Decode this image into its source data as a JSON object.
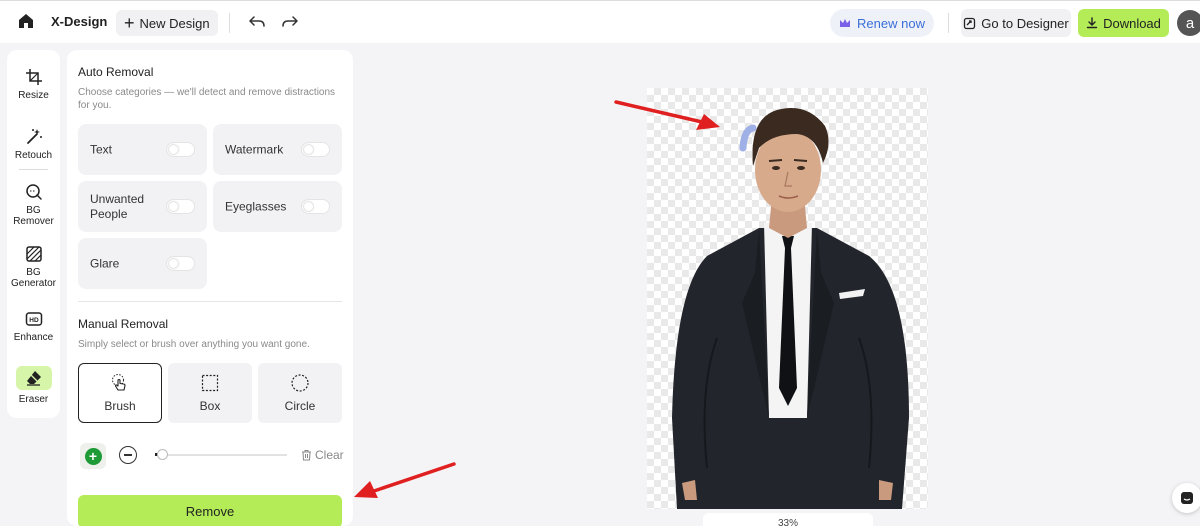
{
  "header": {
    "brand": "X-Design",
    "new_design_label": "New Design",
    "renew_label": "Renew now",
    "goto_label": "Go to Designer",
    "download_label": "Download",
    "avatar_letter": "a"
  },
  "sidebar": {
    "items": [
      {
        "label": "Resize",
        "icon": "crop-icon"
      },
      {
        "label": "Retouch",
        "icon": "magic-wand-icon"
      },
      {
        "label": "BG Remover",
        "icon": "bg-remover-icon"
      },
      {
        "label": "BG Generator",
        "icon": "bg-generator-icon"
      },
      {
        "label": "Enhance",
        "icon": "hd-icon"
      },
      {
        "label": "Eraser",
        "icon": "eraser-icon",
        "active": true
      }
    ]
  },
  "panel": {
    "auto_title": "Auto Removal",
    "auto_desc": "Choose categories — we'll detect and remove distractions for you.",
    "categories": [
      {
        "label": "Text",
        "on": false
      },
      {
        "label": "Watermark",
        "on": false
      },
      {
        "label": "Unwanted People",
        "on": false
      },
      {
        "label": "Eyeglasses",
        "on": false
      },
      {
        "label": "Glare",
        "on": false
      }
    ],
    "manual_title": "Manual Removal",
    "manual_desc": "Simply select or brush over anything you want gone.",
    "tools": [
      {
        "label": "Brush",
        "active": true
      },
      {
        "label": "Box",
        "active": false
      },
      {
        "label": "Circle",
        "active": false
      }
    ],
    "brush_size_fraction": 0.05,
    "clear_label": "Clear",
    "remove_label": "Remove"
  },
  "canvas": {
    "zoom_text": "33%"
  },
  "colors": {
    "accent_green": "#b3ec57",
    "annotation_red": "#e02020",
    "brush_stroke": "#9fb0e6"
  }
}
